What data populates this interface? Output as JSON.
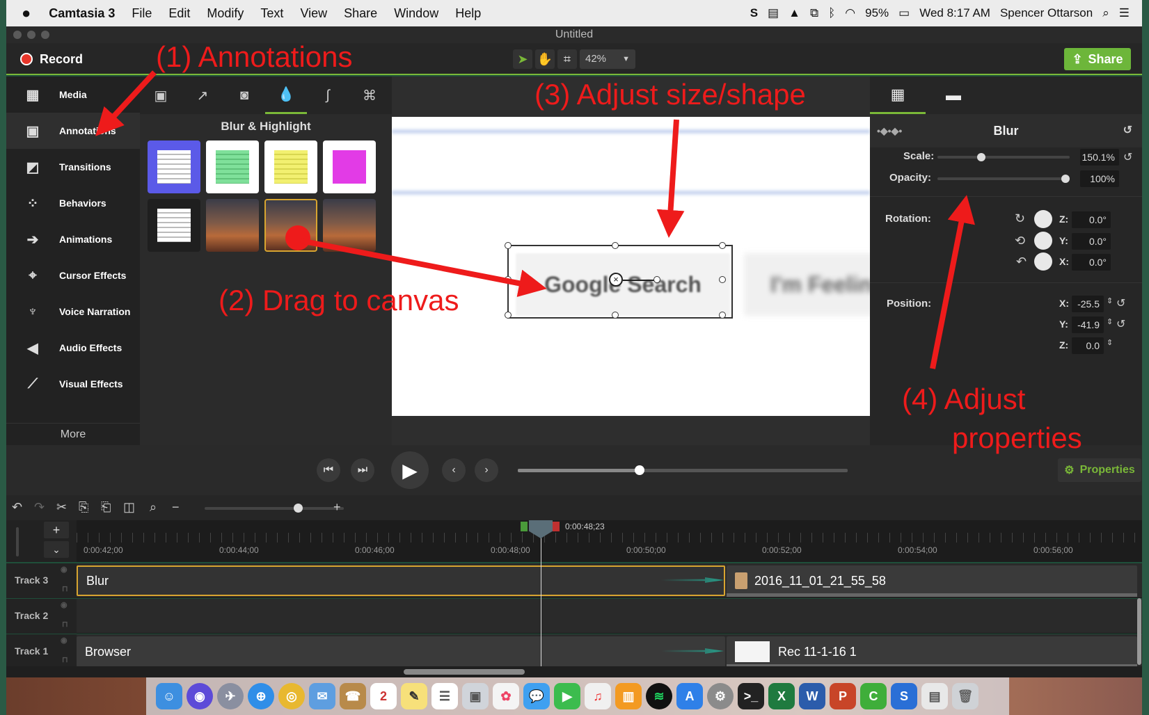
{
  "menubar": {
    "app_name": "Camtasia 3",
    "menus": [
      "File",
      "Edit",
      "Modify",
      "Text",
      "View",
      "Share",
      "Window",
      "Help"
    ],
    "battery": "95%",
    "clock": "Wed 8:17 AM",
    "user": "Spencer Ottarson"
  },
  "window": {
    "title": "Untitled"
  },
  "toolbar": {
    "record_label": "Record",
    "zoom": "42%",
    "share_label": "Share"
  },
  "sidebar": {
    "items": [
      {
        "label": "Media",
        "icon": "film-icon"
      },
      {
        "label": "Annotations",
        "icon": "annotation-icon"
      },
      {
        "label": "Transitions",
        "icon": "transition-icon"
      },
      {
        "label": "Behaviors",
        "icon": "behavior-icon"
      },
      {
        "label": "Animations",
        "icon": "arrow-icon"
      },
      {
        "label": "Cursor Effects",
        "icon": "cursor-icon"
      },
      {
        "label": "Voice Narration",
        "icon": "microphone-icon"
      },
      {
        "label": "Audio Effects",
        "icon": "speaker-icon"
      },
      {
        "label": "Visual Effects",
        "icon": "wand-icon"
      }
    ],
    "more_label": "More"
  },
  "annotations_panel": {
    "section_title": "Blur & Highlight"
  },
  "canvas": {
    "button_text": "Google Search",
    "button2_text": "I'm Feelin"
  },
  "properties": {
    "header": "Blur",
    "scale_label": "Scale:",
    "scale_value": "150.1%",
    "scale_level": 0.32,
    "opacity_label": "Opacity:",
    "opacity_value": "100%",
    "opacity_level": 1.0,
    "rotation_label": "Rotation:",
    "rotation": {
      "z": "0.0°",
      "y": "0.0°",
      "x": "0.0°"
    },
    "position_label": "Position:",
    "position": {
      "x": "-25.5",
      "y": "-41.9",
      "z": "0.0"
    },
    "properties_button": "Properties"
  },
  "playback": {
    "progress": 0.37
  },
  "timeline": {
    "playhead_time": "0:00:48;23",
    "ruler_labels": [
      "0:00:42;00",
      "0:00:44;00",
      "0:00:46;00",
      "0:00:48;00",
      "0:00:50;00",
      "0:00:52;00",
      "0:00:54;00",
      "0:00:56;00"
    ],
    "tracks": [
      {
        "name": "Track 3",
        "clip1": "Blur",
        "clip2": "2016_11_01_21_55_58"
      },
      {
        "name": "Track 2"
      },
      {
        "name": "Track 1",
        "clip1": "Browser",
        "clip2": "Rec 11-1-16 1"
      }
    ]
  },
  "overlay_labels": {
    "step1": "(1)  Annotations",
    "step2": "(2) Drag to canvas",
    "step3": "(3) Adjust size/shape",
    "step4_line1": "(4) Adjust",
    "step4_line2": "properties"
  },
  "colors": {
    "accent": "#7ab838",
    "record": "#e7362a",
    "overlay_red": "#ee1b1b"
  }
}
